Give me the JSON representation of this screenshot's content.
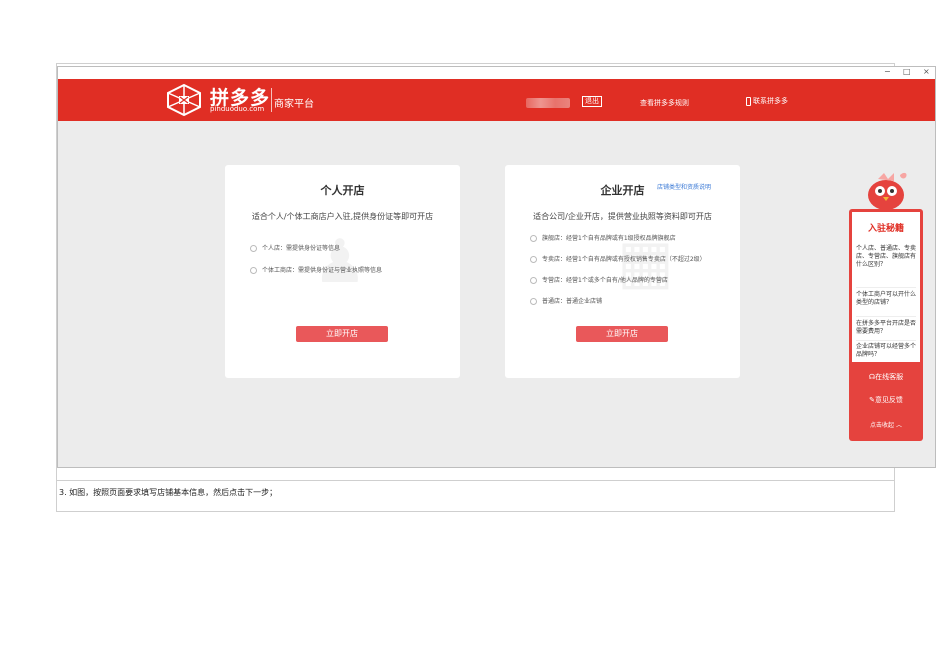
{
  "window_controls": {
    "minimize": "−",
    "maximize": "□",
    "close": "×"
  },
  "header": {
    "brand_name": "拼多多",
    "brand_domain": "pinduoduo.com",
    "brand_sub": "商家平台",
    "logout": "退出",
    "rules_link": "查看拼多多规则",
    "contact": "联系拼多多",
    "brand_color": "#e02e24"
  },
  "cards": {
    "personal": {
      "title": "个人开店",
      "desc": "适合个人/个体工商店户入驻,提供身份证等即可开店",
      "options": [
        "个人店：需提供身份证等信息",
        "个体工商店：需提供身份证与营业执照等信息"
      ],
      "button": "立即开店"
    },
    "enterprise": {
      "title": "企业开店",
      "doc_link": "店铺类型和资质说明",
      "desc": "适合公司/企业开店，提供营业执照等资料即可开店",
      "options": [
        "旗舰店：经营1个自有品牌或有1级授权品牌旗舰店",
        "专卖店：经营1个自有品牌或有授权销售专卖店（不超过2级）",
        "专营店：经营1个或多个自有/他人品牌的专营店",
        "普通店：普通企业店铺"
      ],
      "button": "立即开店"
    }
  },
  "widget": {
    "title": "入驻秘籍",
    "questions": [
      "个人店、普通店、专卖店、专营店、旗舰店有什么区别？",
      "个体工商户可以开什么类型的店铺？",
      "在拼多多平台开店是否需要费用？",
      "企业店铺可以经营多个品牌吗？"
    ],
    "online_service": "在线客服",
    "feedback": "意见反馈",
    "collapse": "点击收起"
  },
  "caption": "3. 如图，按照页面要求填写店铺基本信息，然后点击下一步；"
}
